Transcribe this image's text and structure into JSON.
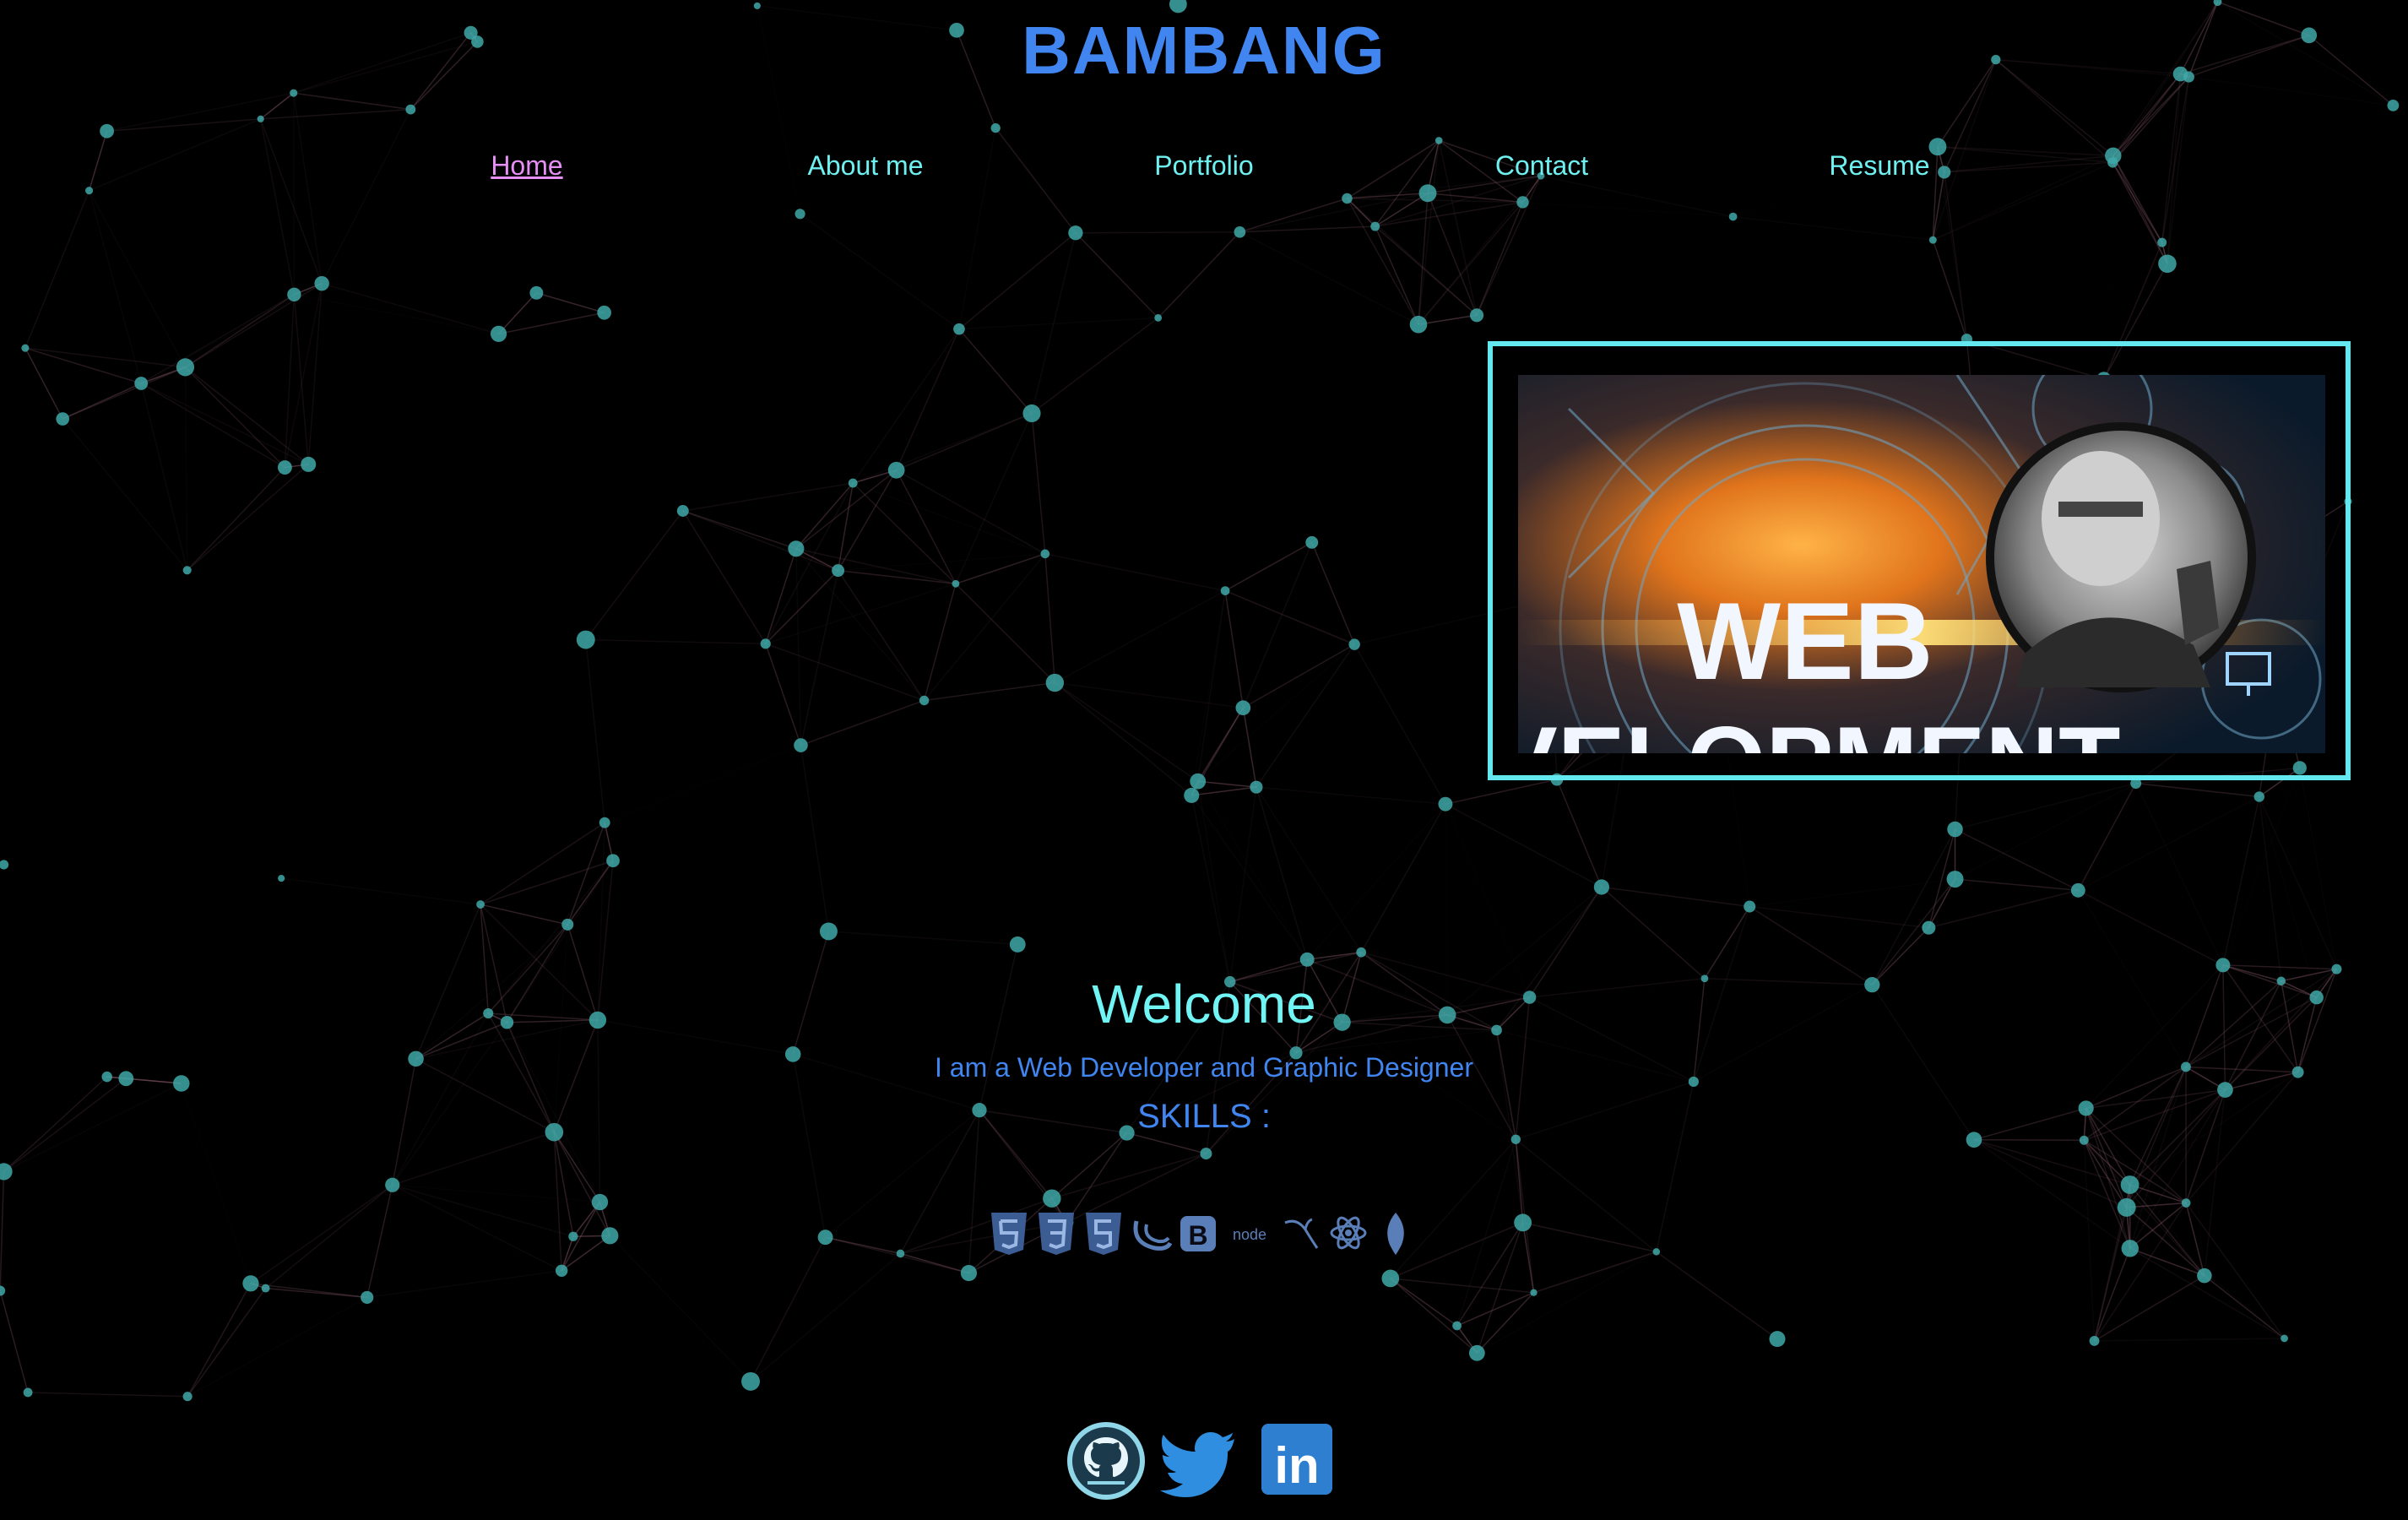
{
  "brand": {
    "name": "BAMBANG",
    "color": "#4186f0"
  },
  "nav": {
    "items": [
      {
        "label": "Home",
        "active": true
      },
      {
        "label": "About me",
        "active": false
      },
      {
        "label": "Portfolio",
        "active": false
      },
      {
        "label": "Contact",
        "active": false
      },
      {
        "label": "Resume",
        "active": false
      }
    ],
    "color": "#6ff0f0",
    "active_color": "#e58ff5"
  },
  "hero": {
    "image_text_line1": "WEB",
    "image_text_line2": "EVELOPMENT",
    "frame_color": "#62e8ee",
    "avatar": "portrait-avatar"
  },
  "welcome": {
    "title": "Welcome",
    "tagline": "I am a Web Developer and Graphic Designer",
    "skills_title": "SKILLS :"
  },
  "skills": [
    {
      "icon": "html5-icon"
    },
    {
      "icon": "css3-icon"
    },
    {
      "icon": "javascript-icon"
    },
    {
      "icon": "jquery-icon"
    },
    {
      "icon": "bootstrap-icon",
      "glyph": "B"
    },
    {
      "icon": "nodejs-icon",
      "glyph": "node"
    },
    {
      "icon": "mysql-icon"
    },
    {
      "icon": "react-icon"
    },
    {
      "icon": "mongodb-icon"
    }
  ],
  "socials": [
    {
      "icon": "github-icon"
    },
    {
      "icon": "twitter-icon"
    },
    {
      "icon": "linkedin-icon",
      "glyph": "in"
    }
  ],
  "colors": {
    "background": "#000000",
    "network_node": "#3fa8a8",
    "network_line": "#8a5a6a",
    "accent": "#4186f0"
  }
}
